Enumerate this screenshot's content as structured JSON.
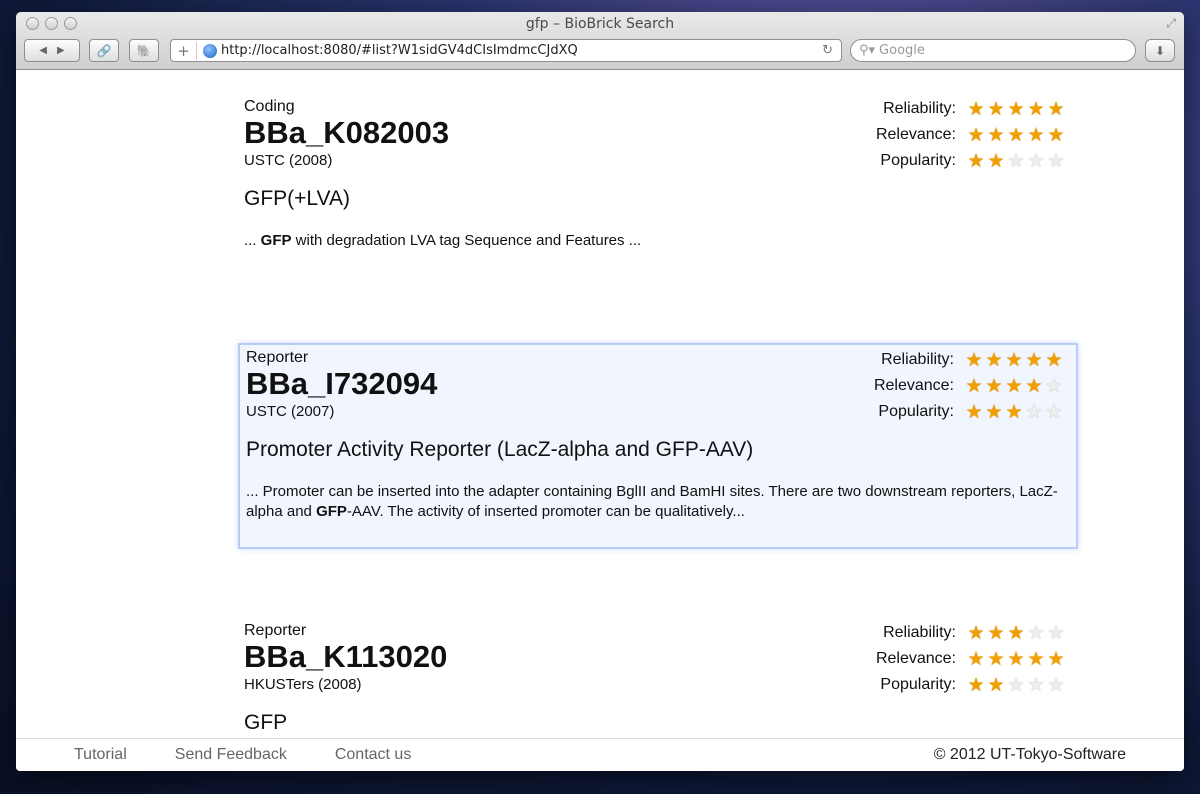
{
  "window": {
    "title": "gfp – BioBrick Search"
  },
  "toolbar": {
    "url": "http://localhost:8080/#list?W1sidGV4dCIsImdmcCJdXQ",
    "search_placeholder": "Google",
    "back": "◀",
    "forward": "▶",
    "add": "+",
    "reload": "↻"
  },
  "results": [
    {
      "category": "Coding",
      "name": "BBa_K082003",
      "team": "USTC (2008)",
      "title": "GFP(+LVA)",
      "snippet_pre": "... ",
      "snippet_bold": "GFP",
      "snippet_post": " with degradation LVA tag Sequence and Features ...",
      "ratings": [
        {
          "label": "Reliability:",
          "value": 5
        },
        {
          "label": "Relevance:",
          "value": 5
        },
        {
          "label": "Popularity:",
          "value": 2
        }
      ]
    },
    {
      "category": "Reporter",
      "name": "BBa_I732094",
      "team": "USTC (2007)",
      "title": "Promoter Activity Reporter (LacZ-alpha and GFP-AAV)",
      "snippet_pre": "... Promoter can be inserted into the adapter containing BglII and BamHI sites. There are two downstream reporters, LacZ-alpha and ",
      "snippet_bold": "GFP",
      "snippet_post": "-AAV. The activity of inserted promoter can be qualitatively...",
      "ratings": [
        {
          "label": "Reliability:",
          "value": 5
        },
        {
          "label": "Relevance:",
          "value": 4
        },
        {
          "label": "Popularity:",
          "value": 3
        }
      ]
    },
    {
      "category": "Reporter",
      "name": "BBa_K113020",
      "team": "HKUSTers (2008)",
      "title": "GFP",
      "snippet_pre": "",
      "snippet_bold": "",
      "snippet_post": "",
      "ratings": [
        {
          "label": "Reliability:",
          "value": 3
        },
        {
          "label": "Relevance:",
          "value": 5
        },
        {
          "label": "Popularity:",
          "value": 2
        }
      ]
    }
  ],
  "footer": {
    "links": [
      "Tutorial",
      "Send Feedback",
      "Contact us"
    ],
    "copyright": "© 2012 UT-Tokyo-Software"
  }
}
